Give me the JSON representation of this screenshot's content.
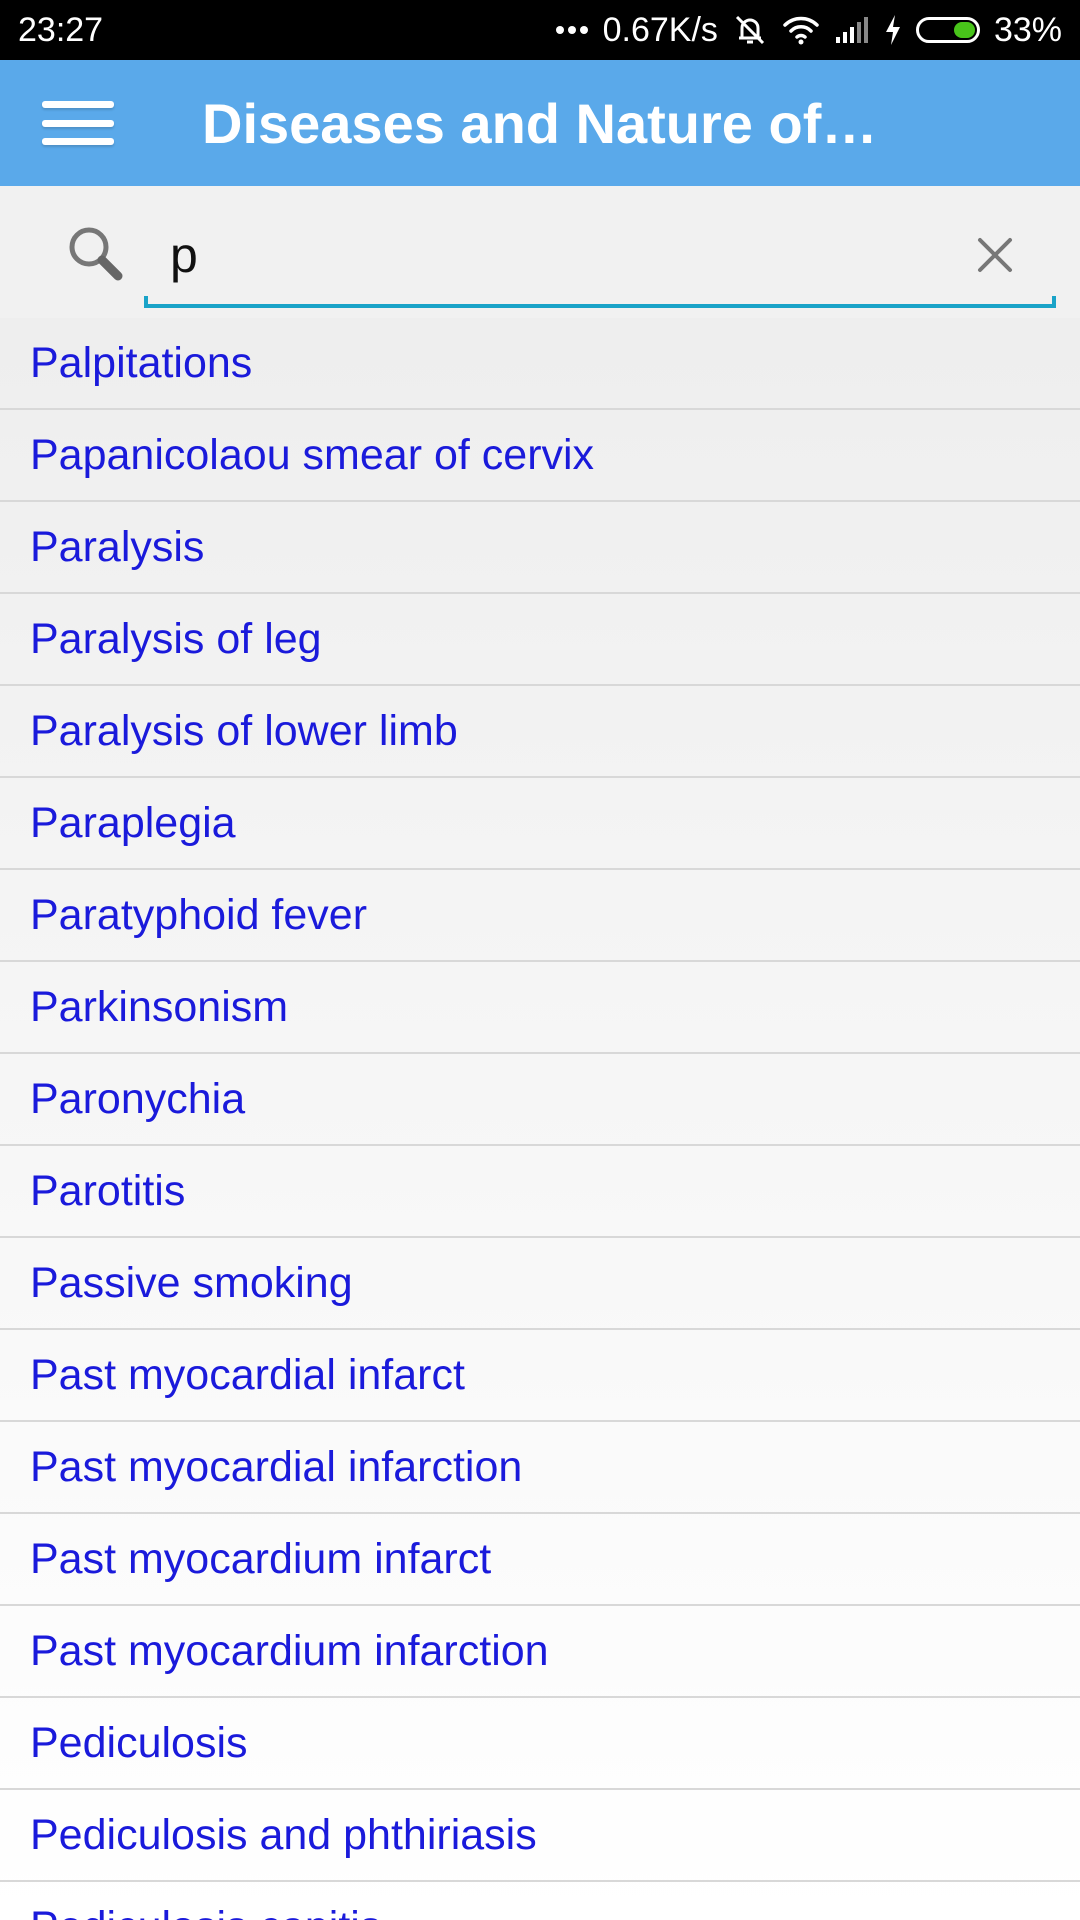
{
  "status_bar": {
    "time": "23:27",
    "network_speed": "0.67K/s",
    "battery_percent": "33%",
    "battery_level": 0.33,
    "icons": [
      "more-dots-icon",
      "mute-icon",
      "wifi-icon",
      "signal-icon",
      "charging-icon",
      "battery-icon"
    ]
  },
  "app_bar": {
    "title": "Diseases and Nature of…",
    "menu_icon": "hamburger-menu-icon"
  },
  "search": {
    "value": "p",
    "icon": "search-icon",
    "clear_icon": "close-icon",
    "accent_color": "#1aa3c8"
  },
  "results": [
    "Palpitations",
    "Papanicolaou smear of cervix",
    "Paralysis",
    "Paralysis of leg",
    "Paralysis of lower limb",
    "Paraplegia",
    "Paratyphoid fever",
    "Parkinsonism",
    "Paronychia",
    "Parotitis",
    "Passive smoking",
    "Past myocardial infarct",
    "Past myocardial infarction",
    "Past myocardium infarct",
    "Past myocardium infarction",
    "Pediculosis",
    "Pediculosis and phthiriasis",
    "Pediculosis capitis"
  ],
  "colors": {
    "app_bar": "#5aa9ea",
    "link_text": "#1a1adb",
    "status_bar": "#000000"
  }
}
